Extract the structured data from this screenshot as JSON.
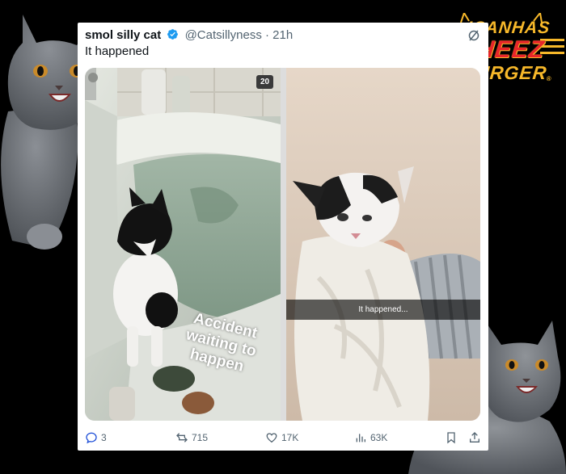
{
  "tweet": {
    "display_name": "smol silly cat",
    "handle": "@Catsillyness",
    "separator": "·",
    "time_ago": "21h",
    "text": "It happened"
  },
  "media": {
    "count_badge": "20",
    "left_caption_lines": [
      "Accident",
      "waiting to",
      "happen"
    ],
    "right_caption": "It happened..."
  },
  "actions": {
    "replies": "3",
    "reposts": "715",
    "likes": "17K",
    "views": "63K"
  },
  "logo": {
    "line1": "ICANHAS",
    "line2": "CHEEZ",
    "line3": "BURGER",
    "trademark": "®"
  },
  "icons": {
    "verified": "verified-badge-icon",
    "grok": "grok-icon",
    "reply": "reply-icon",
    "retweet": "retweet-icon",
    "like": "heart-icon",
    "views": "views-chart-icon",
    "bookmark": "bookmark-icon",
    "share": "share-icon"
  },
  "colors": {
    "background": "#000000",
    "card": "#ffffff",
    "verified_blue": "#1d9bf0",
    "secondary_text": "#536471",
    "logo_yellow": "#f7b82a",
    "logo_red": "#e8262a"
  }
}
